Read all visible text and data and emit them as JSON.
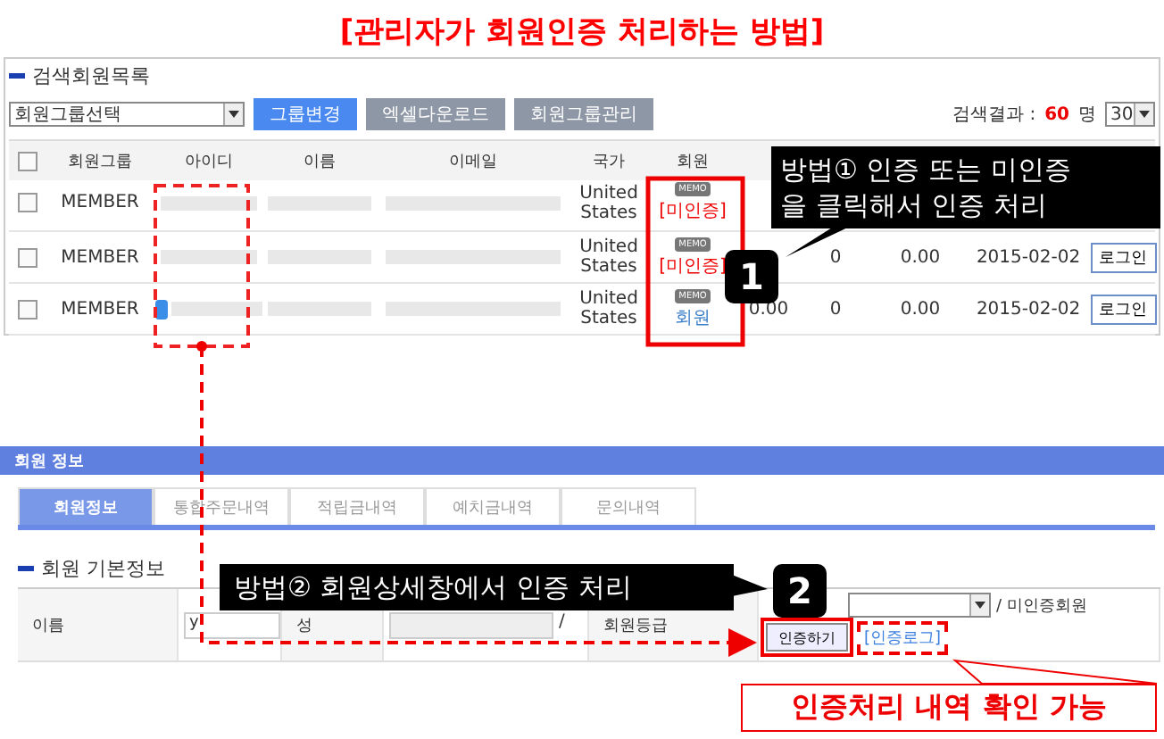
{
  "title": "[관리자가 회원인증 처리하는 방법]",
  "member_list": {
    "heading": "검색회원목록",
    "group_select": "회원그룹선택",
    "buttons": [
      {
        "label": "그룹변경",
        "kind": "primary"
      },
      {
        "label": "엑셀다운로드",
        "kind": "secondary"
      },
      {
        "label": "회원그룹관리",
        "kind": "secondary"
      }
    ],
    "result_label": "검색결과 :",
    "result_count": "60",
    "result_unit": "명",
    "page_size": "30",
    "header_checked": false,
    "columns": [
      "회원그룹",
      "아이디",
      "이름",
      "이메일",
      "국가",
      "회원"
    ],
    "rows": [
      {
        "checked": false,
        "group": "MEMBER",
        "mobile": false,
        "country": "United States",
        "memo": "MEMO",
        "status": "[미인증]",
        "verified": false,
        "cells": [
          "",
          "",
          "",
          "",
          ""
        ],
        "login": ""
      },
      {
        "checked": false,
        "group": "MEMBER",
        "mobile": false,
        "country": "United States",
        "memo": "MEMO",
        "status": "[미인증]",
        "verified": false,
        "cells": [
          "",
          "0",
          "0.00",
          "2015-02-02"
        ],
        "login": "로그인"
      },
      {
        "checked": false,
        "group": "MEMBER",
        "mobile": true,
        "country": "United States",
        "memo": "MEMO",
        "status": "회원",
        "verified": true,
        "cells": [
          "0.00",
          "0",
          "0.00",
          "2015-02-02"
        ],
        "login": "로그인"
      }
    ]
  },
  "member_info": {
    "heading": "회원 정보",
    "tabs": [
      {
        "label": "회원정보",
        "selected": true
      },
      {
        "label": "통합주문내역",
        "selected": false
      },
      {
        "label": "적립금내역",
        "selected": false
      },
      {
        "label": "예치금내역",
        "selected": false
      },
      {
        "label": "문의내역",
        "selected": false
      }
    ],
    "section": "회원 기본정보",
    "name_label": "이름",
    "value_initial": "y",
    "surname_label": "성",
    "slash": "/",
    "grade_label": "회원등급",
    "grade_status": "/ 미인증회원",
    "verify_button": "인증하기",
    "log_link": "[인증로그]"
  },
  "callouts": [
    {
      "number": "1",
      "lines": [
        "방법① 인증 또는 미인증",
        "을 클릭해서 인증 처리"
      ]
    },
    {
      "number": "2",
      "lines": [
        "방법② 회원상세창에서 인증 처리"
      ]
    }
  ],
  "note": "인증처리 내역 확인 가능"
}
